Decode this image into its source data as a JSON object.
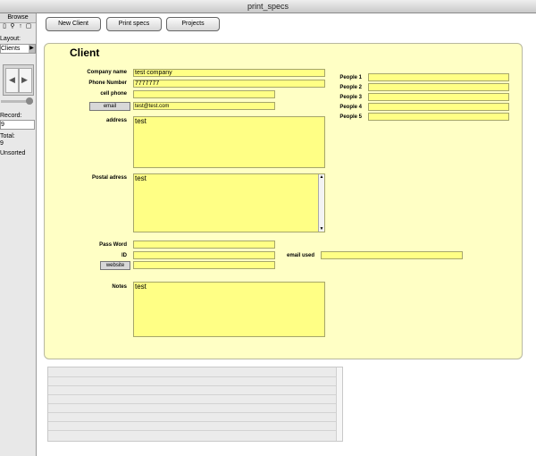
{
  "window": {
    "title": "print_specs"
  },
  "sidebar": {
    "mode": "Browse",
    "layout_label": "Layout:",
    "layout_value": "Clients",
    "record_label": "Record:",
    "record_value": "9",
    "total_label": "Total:",
    "total_value": "9",
    "sort_status": "Unsorted"
  },
  "toolbar": {
    "new_client": "New Client",
    "print_specs": "Print specs",
    "projects": "Projects"
  },
  "form": {
    "title": "Client",
    "company_name": {
      "label": "Company name",
      "value": "test company"
    },
    "phone_number": {
      "label": "Phone Number",
      "value": "7777777"
    },
    "cell_phone": {
      "label": "cell phone",
      "value": ""
    },
    "email": {
      "button": "email",
      "value": "test@test.com"
    },
    "address": {
      "label": "address",
      "value": "test"
    },
    "postal_address": {
      "label": "Postal adress",
      "value": "test"
    },
    "password": {
      "label": "Pass Word",
      "value": ""
    },
    "id": {
      "label": "ID",
      "value": ""
    },
    "email_used": {
      "label": "email used",
      "value": ""
    },
    "website": {
      "button": "website",
      "value": ""
    },
    "notes": {
      "label": "Notes",
      "value": "test"
    },
    "people": [
      {
        "label": "People 1",
        "value": ""
      },
      {
        "label": "People 2",
        "value": ""
      },
      {
        "label": "People 3",
        "value": ""
      },
      {
        "label": "People 4",
        "value": ""
      },
      {
        "label": "People 5",
        "value": ""
      }
    ]
  },
  "colors": {
    "panel": "#ffffc5",
    "field": "#ffff85"
  }
}
